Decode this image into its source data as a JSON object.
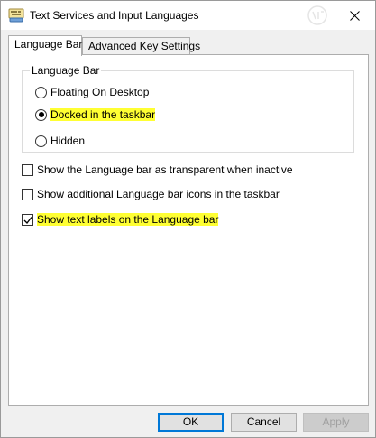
{
  "window": {
    "title": "Text Services and Input Languages"
  },
  "tabs": [
    {
      "label": "Language Bar",
      "active": true
    },
    {
      "label": "Advanced Key Settings",
      "active": false
    }
  ],
  "language_bar_group": {
    "title": "Language Bar",
    "options": [
      {
        "label": "Floating On Desktop",
        "selected": false,
        "highlighted": false
      },
      {
        "label": "Docked in the taskbar",
        "selected": true,
        "highlighted": true
      },
      {
        "label": "Hidden",
        "selected": false,
        "highlighted": false
      }
    ]
  },
  "checkboxes": [
    {
      "label": "Show the Language bar as transparent when inactive",
      "checked": false,
      "highlighted": false
    },
    {
      "label": "Show additional Language bar icons in the taskbar",
      "checked": false,
      "highlighted": false
    },
    {
      "label": "Show text labels on the Language bar",
      "checked": true,
      "highlighted": true
    }
  ],
  "buttons": {
    "ok": "OK",
    "cancel": "Cancel",
    "apply": "Apply"
  },
  "colors": {
    "highlight": "#ffff33",
    "default_button_border": "#0078d7"
  }
}
